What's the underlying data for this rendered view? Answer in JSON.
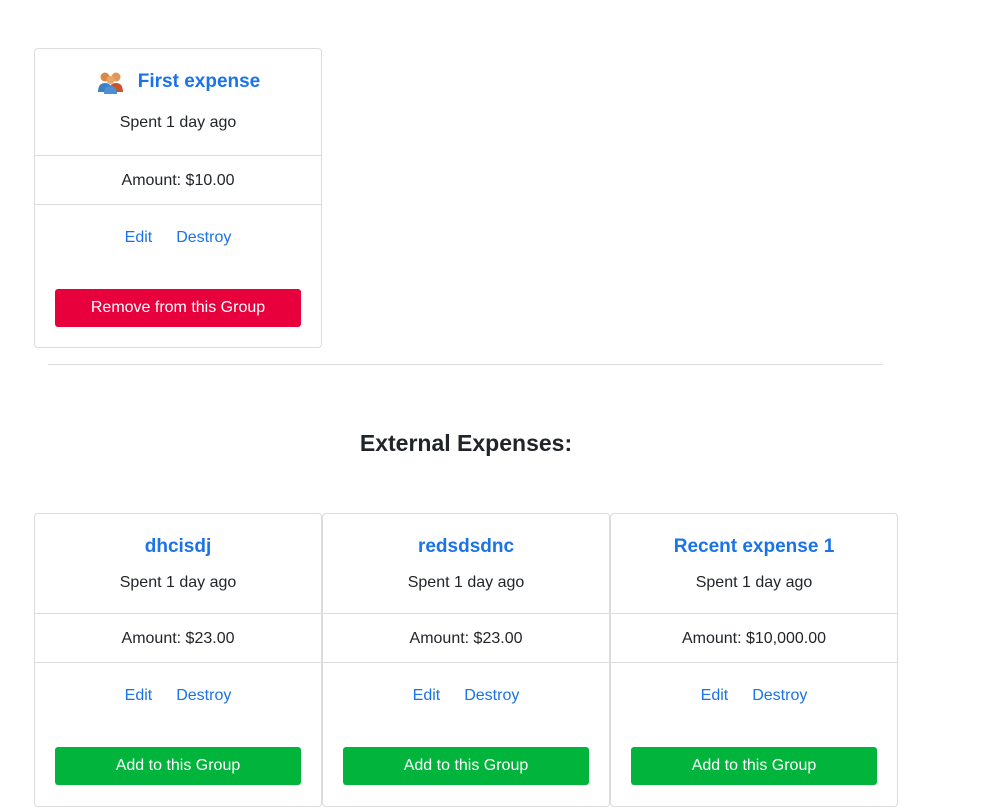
{
  "group_expense": {
    "title": "First expense",
    "spent": "Spent 1 day ago",
    "amount": "Amount: $10.00",
    "edit_label": "Edit",
    "destroy_label": "Destroy",
    "action_label": "Remove from this Group"
  },
  "section_title": "External Expenses:",
  "external_expenses": [
    {
      "title": "dhcisdj",
      "spent": "Spent 1 day ago",
      "amount": "Amount: $23.00",
      "edit_label": "Edit",
      "destroy_label": "Destroy",
      "action_label": "Add to this Group"
    },
    {
      "title": "redsdsdnc",
      "spent": "Spent 1 day ago",
      "amount": "Amount: $23.00",
      "edit_label": "Edit",
      "destroy_label": "Destroy",
      "action_label": "Add to this Group"
    },
    {
      "title": "Recent expense 1",
      "spent": "Spent 1 day ago",
      "amount": "Amount: $10,000.00",
      "edit_label": "Edit",
      "destroy_label": "Destroy",
      "action_label": "Add to this Group"
    }
  ],
  "colors": {
    "link": "#1a73e8",
    "remove_button": "#e8003d",
    "add_button": "#00b43c"
  },
  "icons": {
    "group_icon": "group-users-icon"
  }
}
